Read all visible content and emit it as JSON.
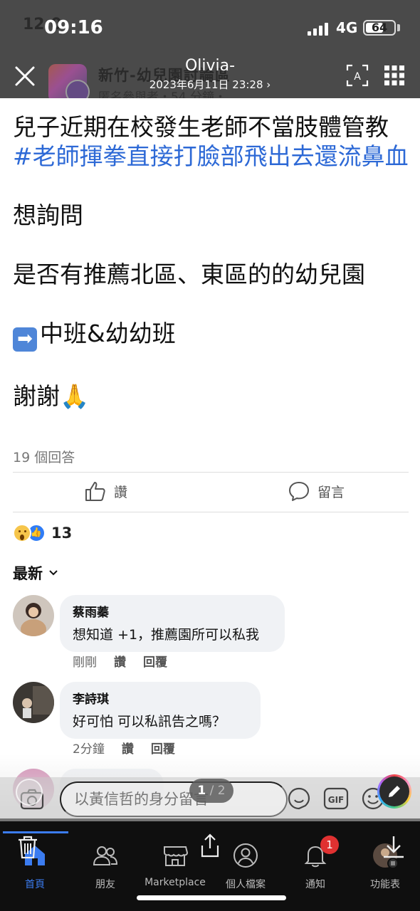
{
  "status_bar": {
    "time": "09:16",
    "network": "4G",
    "battery": "64",
    "battery_level": 0.64,
    "underlying_time": "12:0"
  },
  "viewer": {
    "name": "Olivia-",
    "date": "2023年6月11日 23:28 ›",
    "page_indicator_current": "1",
    "page_indicator_total": "/ 2"
  },
  "group_header": {
    "group_name": "新竹-幼兒園討論區",
    "meta": "匿名參與者・54 分鐘・"
  },
  "post": {
    "line1": "兒子近期在校發生老師不當肢體管教",
    "hashtag": "#老師揮拳直接打臉部飛出去還流鼻血",
    "line_ask": "想詢問",
    "line_question": "是否有推薦北區、東區的的幼兒園",
    "arrow_emoji": "➡",
    "line_classes": "中班&幼幼班",
    "line_thanks": "謝謝🙏",
    "reply_count": "19 個回答",
    "like_label": "讚",
    "comment_label": "留言",
    "reaction_count": "13"
  },
  "sort": {
    "label": "最新"
  },
  "comments": [
    {
      "name": "蔡雨蓁",
      "text": "想知道 +1，推薦園所可以私我",
      "time": "剛剛",
      "like": "讚",
      "reply": "回覆"
    },
    {
      "name": "李詩琪",
      "text": "好可怕 可以私訊告之嗎？",
      "time": "2分鐘",
      "like": "讚",
      "reply": "回覆"
    }
  ],
  "composer": {
    "placeholder": "以黃信哲的身分留言"
  },
  "nav": {
    "tabs": [
      {
        "label": "首頁",
        "icon": "home-icon"
      },
      {
        "label": "朋友",
        "icon": "friends-icon"
      },
      {
        "label": "Marketplace",
        "icon": "marketplace-icon"
      },
      {
        "label": "個人檔案",
        "icon": "profile-icon"
      },
      {
        "label": "通知",
        "icon": "bell-icon",
        "badge": "1"
      },
      {
        "label": "功能表",
        "icon": "menu-avatar-icon"
      }
    ]
  },
  "colors": {
    "hashtag": "#2d69d6",
    "accent": "#3b7cf0",
    "badge": "#e03131"
  }
}
